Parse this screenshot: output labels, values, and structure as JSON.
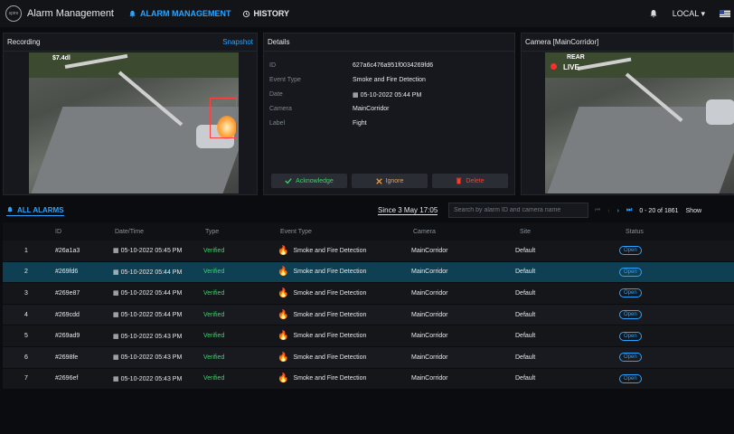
{
  "app": {
    "title": "Alarm Management",
    "logo_text": "spire"
  },
  "nav": {
    "alarm_management": "ALARM MANAGEMENT",
    "history": "HISTORY"
  },
  "header": {
    "locale": "LOCAL"
  },
  "recording": {
    "title": "Recording",
    "snapshot": "Snapshot",
    "overlay_text": "$7.4dl"
  },
  "details": {
    "title": "Details",
    "fields": [
      {
        "label": "ID",
        "value": "627a6c476a951f0034269fd6"
      },
      {
        "label": "Event Type",
        "value": "Smoke and Fire Detection"
      },
      {
        "label": "Date",
        "value": "05-10-2022 05:44 PM"
      },
      {
        "label": "Camera",
        "value": "MainCorridor"
      },
      {
        "label": "Label",
        "value": "Fight"
      }
    ],
    "buttons": {
      "acknowledge": "Acknowledge",
      "ignore": "Ignore",
      "delete": "Delete"
    }
  },
  "camera": {
    "title": "Camera [MainCorridor]",
    "overlay_text": "REAR",
    "live": "LIVE"
  },
  "alarms": {
    "tab": "ALL ALARMS",
    "since": "Since 3 May 17:05",
    "search_placeholder": "Search by alarm ID and camera name",
    "pager_text": "0 - 20 of 1861",
    "pager_extra": "Show"
  },
  "table": {
    "headers": [
      "ID",
      "Date/Time",
      "Type",
      "Event Type",
      "Camera",
      "Site",
      "Status"
    ],
    "rows": [
      {
        "n": "1",
        "id": "#26a1a3",
        "dt": "05-10-2022 05:45 PM",
        "type": "Verified",
        "event": "Smoke and Fire Detection",
        "camera": "MainCorridor",
        "site": "Default",
        "status": "Open"
      },
      {
        "n": "2",
        "id": "#269fd6",
        "dt": "05-10-2022 05:44 PM",
        "type": "Verified",
        "event": "Smoke and Fire Detection",
        "camera": "MainCorridor",
        "site": "Default",
        "status": "Open"
      },
      {
        "n": "3",
        "id": "#269e87",
        "dt": "05-10-2022 05:44 PM",
        "type": "Verified",
        "event": "Smoke and Fire Detection",
        "camera": "MainCorridor",
        "site": "Default",
        "status": "Open"
      },
      {
        "n": "4",
        "id": "#269cdd",
        "dt": "05-10-2022 05:44 PM",
        "type": "Verified",
        "event": "Smoke and Fire Detection",
        "camera": "MainCorridor",
        "site": "Default",
        "status": "Open"
      },
      {
        "n": "5",
        "id": "#269ad9",
        "dt": "05-10-2022 05:43 PM",
        "type": "Verified",
        "event": "Smoke and Fire Detection",
        "camera": "MainCorridor",
        "site": "Default",
        "status": "Open"
      },
      {
        "n": "6",
        "id": "#2698fe",
        "dt": "05-10-2022 05:43 PM",
        "type": "Verified",
        "event": "Smoke and Fire Detection",
        "camera": "MainCorridor",
        "site": "Default",
        "status": "Open"
      },
      {
        "n": "7",
        "id": "#2696ef",
        "dt": "05-10-2022 05:43 PM",
        "type": "Verified",
        "event": "Smoke and Fire Detection",
        "camera": "MainCorridor",
        "site": "Default",
        "status": "Open"
      }
    ],
    "selected_row": 1
  },
  "colors": {
    "accent": "#2aa4ff",
    "verified": "#3dd26b",
    "danger": "#ff3b30",
    "selected_row": "#0f3f52"
  }
}
